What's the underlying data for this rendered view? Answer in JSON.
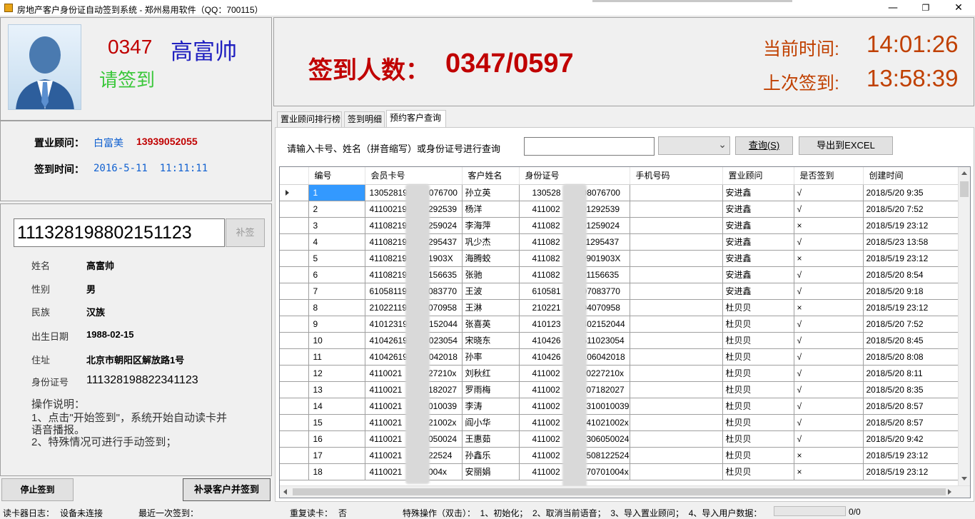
{
  "window": {
    "title": "房地产客户身份证自动签到系统 - 郑州易用软件（QQ：700115）",
    "min": "—",
    "max": "❐",
    "close": "✕"
  },
  "current": {
    "number": "0347",
    "name": "高富帅",
    "prompt": "请签到"
  },
  "advisor": {
    "label": "置业顾问：",
    "name": "白富美",
    "phone": "13939052055",
    "time_label": "签到时间：",
    "time": "2016-5-11  11:11:11"
  },
  "card": {
    "input_value": "111328198802151123",
    "supplement_btn": "补签",
    "fields": [
      {
        "label": "姓名",
        "value": "高富帅"
      },
      {
        "label": "性别",
        "value": "男"
      },
      {
        "label": "民族",
        "value": "汉族"
      },
      {
        "label": "出生日期",
        "value": "1988-02-15"
      },
      {
        "label": "住址",
        "value": "北京市朝阳区解放路1号"
      },
      {
        "label": "身份证号",
        "value": "111328198822341123"
      }
    ],
    "instructions_title": "操作说明：",
    "instructions": [
      "1、点击\"开始签到\"，系统开始自动读卡并",
      "语音播报。",
      "2、特殊情况可进行手动签到；"
    ]
  },
  "buttons": {
    "stop": "停止签到",
    "add_customer": "补录客户并签到",
    "query": "查询(S)",
    "export": "导出到EXCEL"
  },
  "stats": {
    "count_label": "签到人数：",
    "count": "0347/0597",
    "now_label": "当前时间:",
    "now": "14:01:26",
    "last_label": "上次签到:",
    "last": "13:58:39"
  },
  "tabs": [
    "置业顾问排行榜",
    "签到明细",
    "预约客户查询"
  ],
  "search": {
    "label": "请输入卡号、姓名（拼音缩写）或身份证号进行查询",
    "value": "",
    "dropdown": "",
    "chevron": "⌄"
  },
  "table": {
    "columns": [
      "编号",
      "会员卡号",
      "客户姓名",
      "身份证号",
      "手机号码",
      "置业顾问",
      "是否签到",
      "创建时间"
    ],
    "rows": [
      [
        "1",
        "13052819",
        "076700",
        "孙立英",
        "130528",
        "08076700",
        "",
        "安进鑫",
        "√",
        "2018/5/20 9:35"
      ],
      [
        "2",
        "41100219",
        "292539",
        "杨洋",
        "411002",
        "01292539",
        "",
        "安进鑫",
        "√",
        "2018/5/20 7:52"
      ],
      [
        "3",
        "41108219",
        "259024",
        "李海萍",
        "411082",
        "01259024",
        "",
        "安进鑫",
        "×",
        "2018/5/19 23:12"
      ],
      [
        "4",
        "41108219",
        "295437",
        "巩少杰",
        "411082",
        "11295437",
        "",
        "安进鑫",
        "√",
        "2018/5/23 13:58"
      ],
      [
        "5",
        "41108219",
        "1903X",
        "海腾蛟",
        "411082",
        "0901903X",
        "",
        "安进鑫",
        "×",
        "2018/5/19 23:12"
      ],
      [
        "6",
        "41108219",
        "156635",
        "张驰",
        "411082",
        "01156635",
        "",
        "安进鑫",
        "√",
        "2018/5/20 8:54"
      ],
      [
        "7",
        "61058119",
        "083770",
        "王波",
        "610581",
        "07083770",
        "",
        "安进鑫",
        "√",
        "2018/5/20 9:18"
      ],
      [
        "8",
        "21022119",
        "070958",
        "王淋",
        "210221",
        "04070958",
        "",
        "杜贝贝",
        "×",
        "2018/5/19 23:12"
      ],
      [
        "9",
        "41012319",
        "152044",
        "张喜英",
        "410123",
        "402152044",
        "",
        "杜贝贝",
        "√",
        "2018/5/20 7:52"
      ],
      [
        "10",
        "41042619",
        "023054",
        "宋晓东",
        "410426",
        "511023054",
        "",
        "杜贝贝",
        "√",
        "2018/5/20 8:45"
      ],
      [
        "11",
        "41042619",
        "042018",
        "孙率",
        "410426",
        "106042018",
        "",
        "杜贝贝",
        "√",
        "2018/5/20 8:08"
      ],
      [
        "12",
        "4110021",
        "227210x",
        "刘秋红",
        "411002",
        "90227210x",
        "",
        "杜贝贝",
        "√",
        "2018/5/20 8:11"
      ],
      [
        "13",
        "4110021",
        "7182027",
        "罗雨梅",
        "411002",
        "207182027",
        "",
        "杜贝贝",
        "√",
        "2018/5/20 8:35"
      ],
      [
        "14",
        "4110021",
        "0010039",
        "李涛",
        "411002",
        "7310010039",
        "",
        "杜贝贝",
        "√",
        "2018/5/20 8:57"
      ],
      [
        "15",
        "4110021",
        "021002x",
        "阎小华",
        "411002",
        "741021002x",
        "",
        "杜贝贝",
        "√",
        "2018/5/20 8:57"
      ],
      [
        "16",
        "4110021",
        "6050024",
        "王惠茹",
        "411002",
        "8306050024",
        "",
        "杜贝贝",
        "√",
        "2018/5/20 9:42"
      ],
      [
        "17",
        "4110021",
        "122524",
        "孙鑫乐",
        "411002",
        "8508122524",
        "",
        "杜贝贝",
        "×",
        "2018/5/19 23:12"
      ],
      [
        "18",
        "4110021",
        "1004x",
        "安丽娟",
        "411002",
        "370701004x",
        "",
        "杜贝贝",
        "×",
        "2018/5/19 23:12"
      ]
    ]
  },
  "status": {
    "reader_log_label": "读卡器日志：",
    "reader_log": "设备未连接",
    "last_read_label": "最近一次签到：",
    "last_read": "",
    "repeat_label": "重复读卡：",
    "repeat": "否",
    "special_ops": "特殊操作（双击）：  1、初始化；  2、取消当前语音；  3、导入置业顾问；  4、导入用户数据：",
    "progress": "0/0"
  },
  "colors": {
    "dark_red": "#c00000",
    "blue": "#2020c0",
    "green": "#3ac73a",
    "orange": "#c04000",
    "link_blue": "#1060d0",
    "gray_blur": "#d9d9d9"
  }
}
